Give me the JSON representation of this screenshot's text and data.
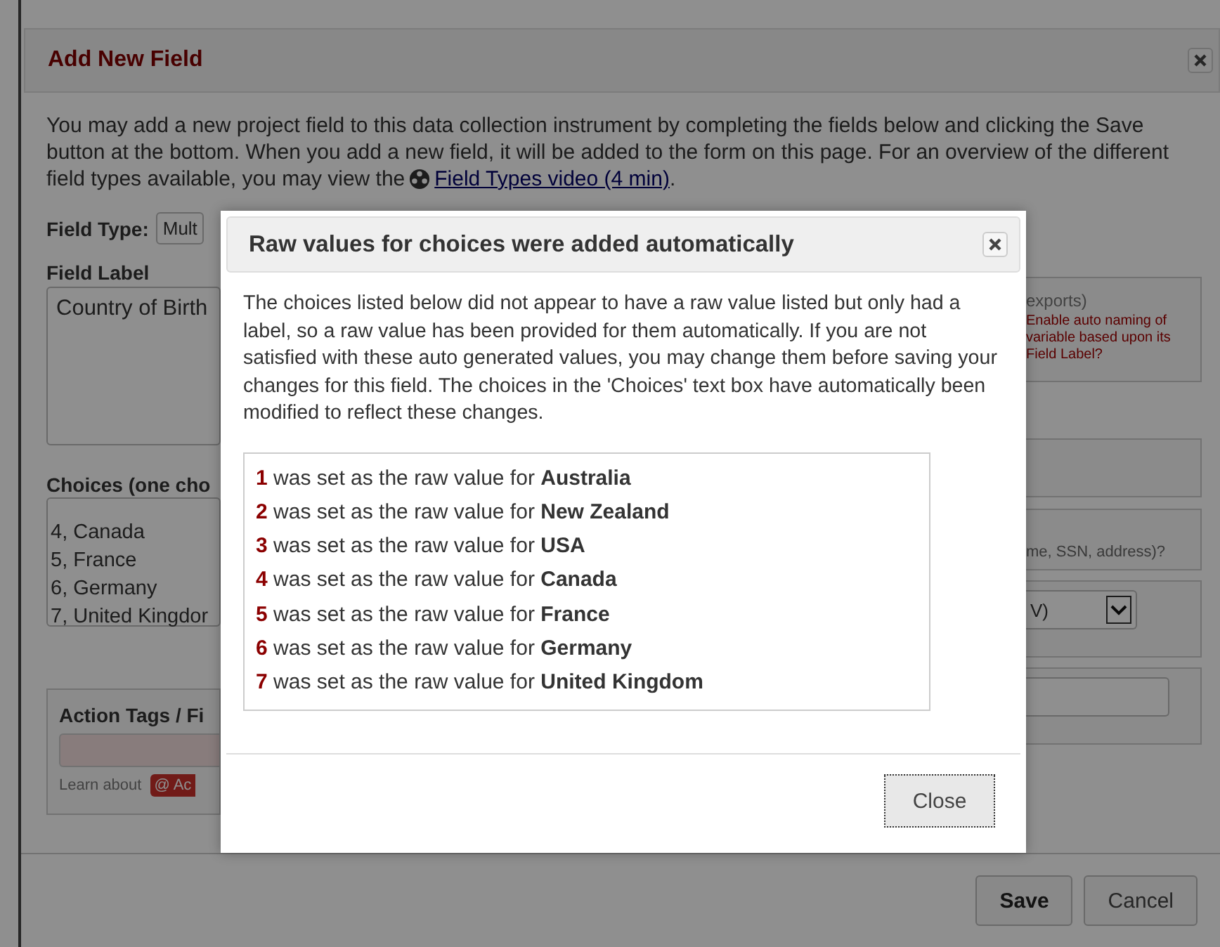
{
  "dialog": {
    "title": "Add New Field",
    "intro": {
      "text": "You may add a new project field to this data collection instrument by completing the fields below and clicking the Save button at the bottom. When you add a new field, it will be added to the form on this page. For an overview of the different field types available, you may view the",
      "link": "Field Types video (4 min)",
      "after": "."
    },
    "form": {
      "field_type_label": "Field Type:",
      "field_type_value": "Mult",
      "field_label_label": "Field Label",
      "field_label_value": "Country of Birth",
      "choices_label": "Choices (one cho",
      "choices": [
        "4, Canada",
        "5, France",
        "6, Germany",
        "7, United Kingdor"
      ],
      "action_tags_label": "Action Tags / Fi",
      "learn_about": "Learn about",
      "action_tags_badge": "@ Ac"
    },
    "right_panels": {
      "export_note": "exports)",
      "auto_naming": "Enable auto naming of variable based upon its Field Label?",
      "identifier_note": "me, SSN, address)?",
      "validation_value": "V)"
    },
    "footer_buttons": [
      {
        "label": "Save",
        "primary": true
      },
      {
        "label": "Cancel",
        "primary": false
      }
    ]
  },
  "modal": {
    "title": "Raw values for choices were added automatically",
    "message": "The choices listed below did not appear to have a raw value listed but only had a label, so a raw value has been provided for them automatically. If you are not satisfied with these auto generated values, you may change them before saving your changes for this field. The choices in the 'Choices' text box have automatically been modified to reflect these changes.",
    "items": [
      {
        "value": "1",
        "text": "was set as the raw value for",
        "label": "Australia"
      },
      {
        "value": "2",
        "text": "was set as the raw value for",
        "label": "New Zealand"
      },
      {
        "value": "3",
        "text": "was set as the raw value for",
        "label": "USA"
      },
      {
        "value": "4",
        "text": "was set as the raw value for",
        "label": "Canada"
      },
      {
        "value": "5",
        "text": "was set as the raw value for",
        "label": "France"
      },
      {
        "value": "6",
        "text": "was set as the raw value for",
        "label": "Germany"
      },
      {
        "value": "7",
        "text": "was set as the raw value for",
        "label": "United Kingdom"
      }
    ],
    "close_button": "Close"
  }
}
